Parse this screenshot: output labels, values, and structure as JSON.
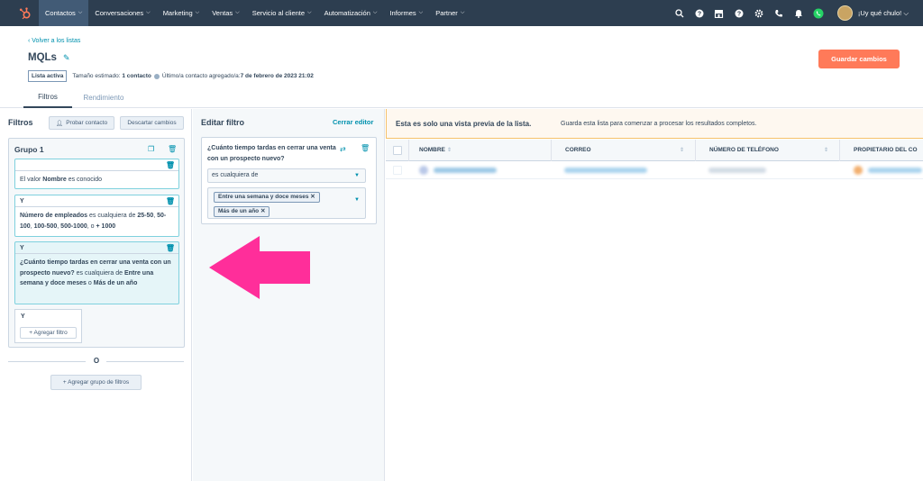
{
  "nav": {
    "items": [
      {
        "label": "Contactos",
        "active": true
      },
      {
        "label": "Conversaciones",
        "active": false
      },
      {
        "label": "Marketing",
        "active": false
      },
      {
        "label": "Ventas",
        "active": false
      },
      {
        "label": "Servicio al cliente",
        "active": false
      },
      {
        "label": "Automatización",
        "active": false
      },
      {
        "label": "Informes",
        "active": false
      },
      {
        "label": "Partner",
        "active": false
      }
    ],
    "user_name": "¡Uy qué chulo!",
    "icons": [
      "search-icon",
      "calling-icon",
      "marketplace-icon",
      "help-icon",
      "settings-icon",
      "phone-icon",
      "notifications-icon",
      "whatsapp-icon"
    ]
  },
  "header": {
    "back_link": "‹ Volver a los listas",
    "title": "MQLs",
    "status_badge": "Lista activa",
    "size_label": "Tamaño estimado:",
    "size_value": "1 contacto",
    "last_added_label": "Último/a contacto agregado/a:",
    "last_added_value": "7 de febrero de 2023 21:02",
    "save_button": "Guardar cambios"
  },
  "tabs": [
    {
      "label": "Filtros",
      "active": true
    },
    {
      "label": "Rendimiento",
      "active": false
    }
  ],
  "filters": {
    "title": "Filtros",
    "test_contact_button": "Probar contacto",
    "discard_button": "Descartar cambios",
    "group_title": "Grupo 1",
    "and_label": "Y",
    "filter1": {
      "prefix": "El valor ",
      "property": "Nombre",
      "suffix": " es conocido"
    },
    "filter2": {
      "property": "Número de empleados",
      "op": " es cualquiera de ",
      "v1": "25-50",
      "v2": "50-100",
      "v3": "100-500",
      "v4": "500-1000",
      "or_word": "o",
      "v5": "+ 1000"
    },
    "filter3": {
      "property": "¿Cuánto tiempo tardas en cerrar una venta con un prospecto nuevo?",
      "op": " es cualquiera de ",
      "v1": "Entre una semana y doce meses",
      "or_word": " o ",
      "v2": "Más de un año"
    },
    "add_filter_button": "+ Agregar filtro",
    "or_label": "O",
    "add_group_button": "+ Agregar grupo de filtros"
  },
  "editor": {
    "title": "Editar filtro",
    "close_label": "Cerrar editor",
    "question": "¿Cuánto tiempo tardas en cerrar una venta con un prospecto nuevo?",
    "operator": "es cualquiera de",
    "chips": [
      "Entre una semana y doce meses",
      "Más de un año"
    ]
  },
  "preview": {
    "banner_bold": "Esta es solo una vista previa de la lista.",
    "banner_text": "Guarda esta lista para comenzar a procesar los resultados completos.",
    "columns": [
      "NOMBRE",
      "CORREO",
      "NÚMERO DE TELÉFONO",
      "PROPIETARIO DEL CO"
    ]
  },
  "colors": {
    "nav_bg": "#2d3e50",
    "accent": "#0091ae",
    "primary_button": "#ff7a59",
    "annotation_arrow": "#ff2e9a"
  }
}
